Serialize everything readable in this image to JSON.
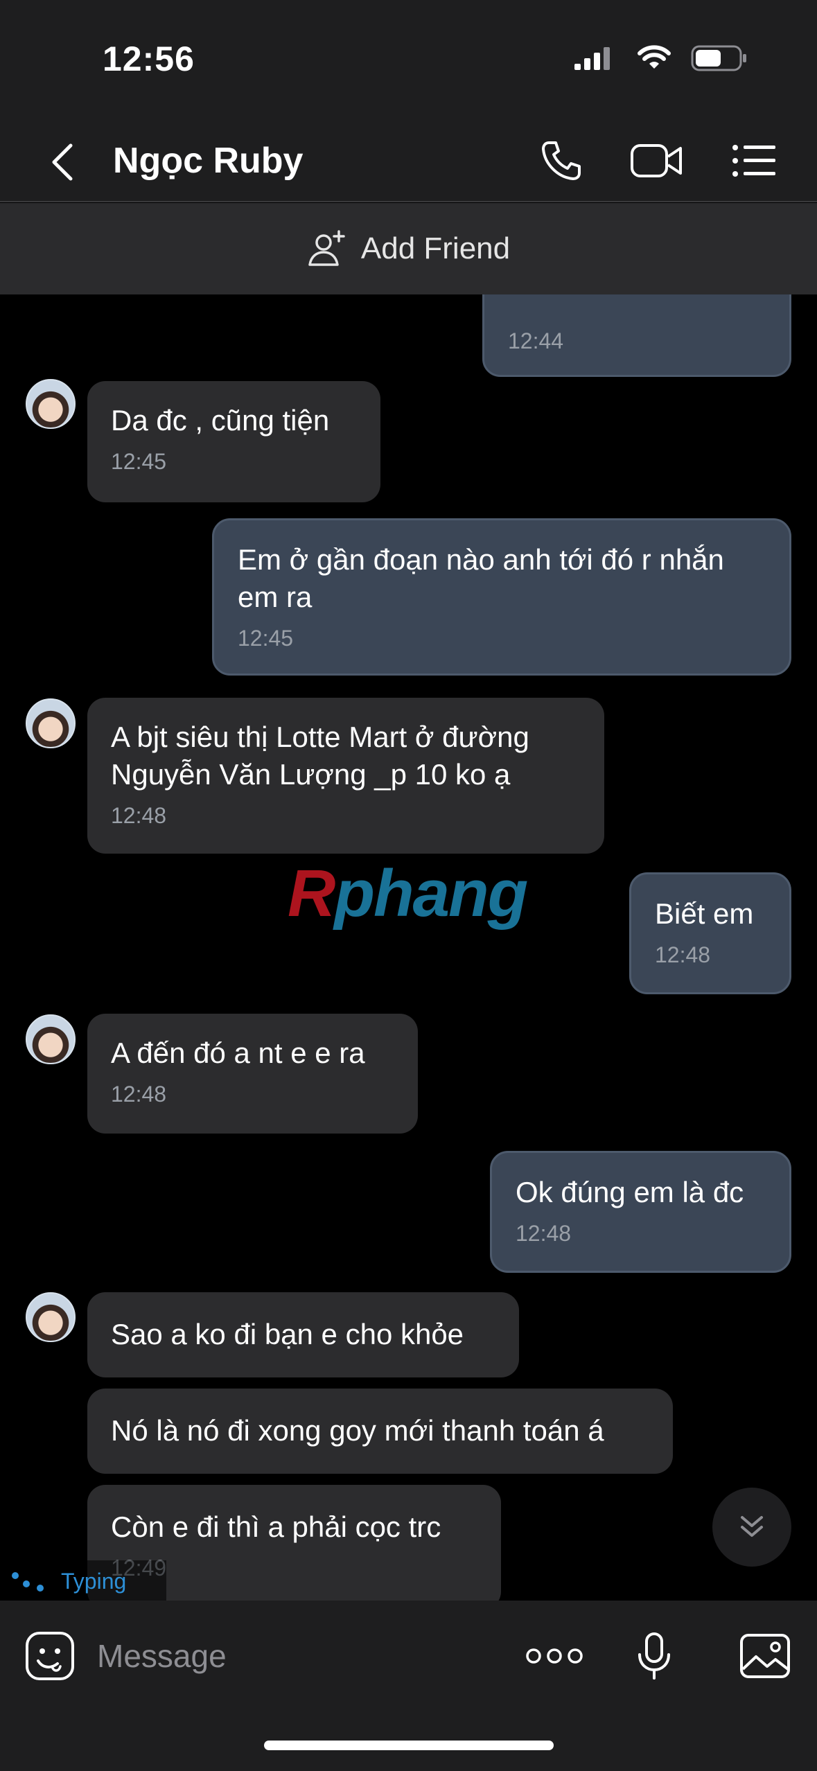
{
  "status_bar": {
    "time": "12:56"
  },
  "header": {
    "contact_name": "Ngọc Ruby"
  },
  "add_friend": {
    "label": "Add Friend"
  },
  "watermark": {
    "text_r": "R",
    "text_rest": "phang"
  },
  "messages": [
    {
      "direction": "out",
      "text": "",
      "time": "12:44"
    },
    {
      "direction": "in",
      "text": "Da đc , cũng tiện",
      "time": "12:45"
    },
    {
      "direction": "out",
      "text": "Em ở gần đoạn nào anh tới đó r nhắn em ra",
      "time": "12:45"
    },
    {
      "direction": "in",
      "text": "A bjt siêu thị Lotte Mart ở đường Nguyễn Văn Lượng _p 10 ko ạ",
      "time": "12:48"
    },
    {
      "direction": "out",
      "text": "Biết em",
      "time": "12:48"
    },
    {
      "direction": "in",
      "text": "A đến đó a nt e e ra",
      "time": "12:48"
    },
    {
      "direction": "out",
      "text": "Ok đúng em là đc",
      "time": "12:48"
    },
    {
      "direction": "in",
      "text": "Sao a ko đi bạn e cho khỏe",
      "time": ""
    },
    {
      "direction": "in",
      "text": "Nó là nó đi xong goy mới thanh toán á",
      "time": ""
    },
    {
      "direction": "in",
      "text": "Còn e đi thì a phải cọc trc",
      "time": "12:49"
    }
  ],
  "typing_indicator": {
    "label": "Typing"
  },
  "input_bar": {
    "placeholder": "Message"
  },
  "colors": {
    "background": "#000000",
    "bar": "#1e1e1f",
    "incoming_bubble": "#2c2c2e",
    "outgoing_bubble": "#3b4656",
    "typing_accent": "#2d8fd6"
  },
  "icons": [
    "back-icon",
    "phone-icon",
    "video-call-icon",
    "menu-list-icon",
    "add-person-icon",
    "chevron-double-down-icon",
    "sticker-icon",
    "more-dots-icon",
    "microphone-icon",
    "image-icon",
    "signal-icon",
    "wifi-icon",
    "battery-icon"
  ]
}
